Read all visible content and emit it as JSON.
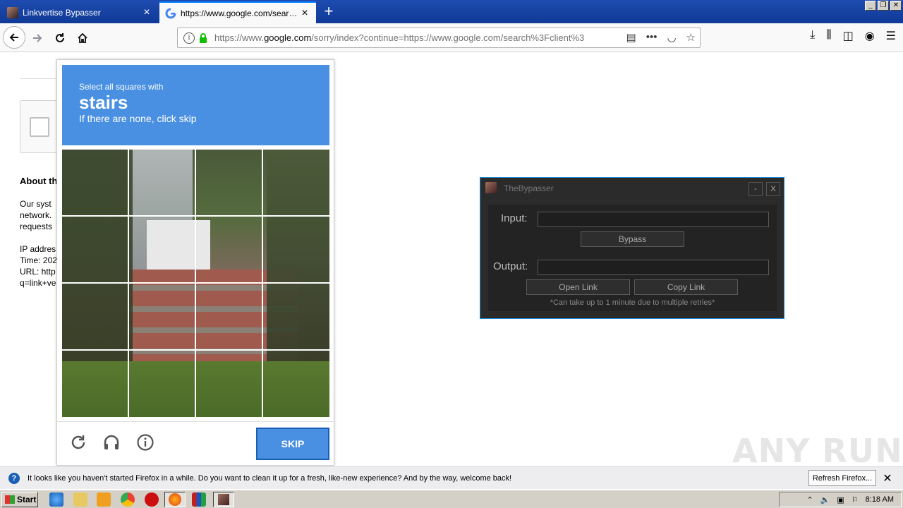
{
  "browser": {
    "tabs": [
      {
        "title": "Linkvertise Bypasser",
        "active": false
      },
      {
        "title": "https://www.google.com/search?c",
        "active": true
      }
    ],
    "url_prefix": "https://www.",
    "url_domain": "google.com",
    "url_rest": "/sorry/index?continue=https://www.google.com/search%3Fclient%3"
  },
  "page": {
    "about_title": "About th",
    "about_lines": [
      "Our syst",
      "network.",
      "requests",
      "",
      "IP addres",
      "Time: 202",
      "URL: http",
      "q=link+ve"
    ]
  },
  "captcha": {
    "instruction": "Select all squares with",
    "target": "stairs",
    "hint": "If there are none, click skip",
    "skip_label": "SKIP"
  },
  "bypasser": {
    "title": "TheBypasser",
    "minimize": "-",
    "close": "X",
    "input_label": "Input:",
    "input_value": "",
    "bypass_label": "Bypass",
    "output_label": "Output:",
    "output_value": "",
    "open_link_label": "Open Link",
    "copy_link_label": "Copy Link",
    "note": "*Can take up to 1 minute due to multiple retries*"
  },
  "notification": {
    "message": "It looks like you haven't started Firefox in a while. Do you want to clean it up for a fresh, like-new experience? And by the way, welcome back!",
    "refresh_label": "Refresh Firefox..."
  },
  "taskbar": {
    "start_label": "Start",
    "clock": "8:18 AM"
  },
  "watermark": "ANY RUN",
  "colors": {
    "captcha_blue": "#4a90e2",
    "bypasser_border": "#1a8ad4",
    "lock_green": "#12bc00"
  }
}
